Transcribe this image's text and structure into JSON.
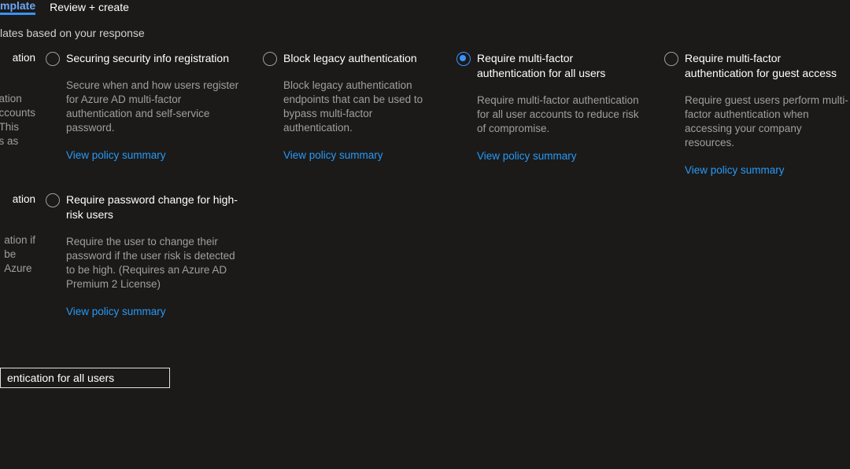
{
  "tabs": {
    "active": "mplate",
    "next": "Review + create"
  },
  "subtitle": "lates based on your response",
  "leftFragments": {
    "row1_title_end": "ation",
    "row1_desc": "ation\nccounts\nThis\ns as",
    "row2_title_end": "ation",
    "row2_desc": "ation if\nbe\nAzure"
  },
  "cards": [
    {
      "id": "securing-registration",
      "title": "Securing security info registration",
      "desc": "Secure when and how users register for Azure AD multi-factor authentication and self-service password.",
      "link": "View policy summary",
      "selected": false
    },
    {
      "id": "block-legacy-auth",
      "title": "Block legacy authentication",
      "desc": "Block legacy authentication endpoints that can be used to bypass multi-factor authentication.",
      "link": "View policy summary",
      "selected": false
    },
    {
      "id": "mfa-all-users",
      "title": "Require multi-factor authentication for all users",
      "desc": "Require multi-factor authentication for all user accounts to reduce risk of compromise.",
      "link": "View policy summary",
      "selected": true
    },
    {
      "id": "mfa-guest",
      "title": "Require multi-factor authentication for guest access",
      "desc": "Require guest users perform multi-factor authentication when accessing your company resources.",
      "link": "View policy summary",
      "selected": false
    },
    {
      "id": "password-change-high-risk",
      "title": "Require password change for high-risk users",
      "desc": "Require the user to change their password if the user risk is detected to be high. (Requires an Azure AD Premium 2 License)",
      "link": "View policy summary",
      "selected": false
    }
  ],
  "policyNameValue": "entication for all users"
}
